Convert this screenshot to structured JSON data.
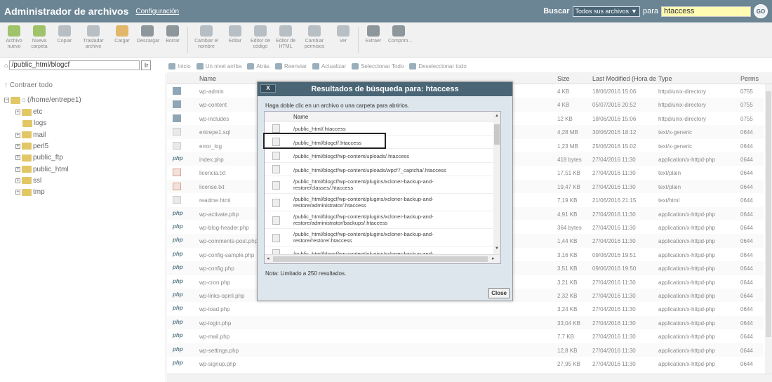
{
  "header": {
    "title": "Administrador de archivos",
    "settings_link": "Configuración",
    "search_label": "Buscar",
    "search_scope": "Todos sus archivos",
    "search_for_label": "para",
    "search_query": "htaccess",
    "go_label": "GO"
  },
  "toolbar": [
    {
      "icon": "new-file-icon",
      "label": "Archivo nuevo",
      "style": "green"
    },
    {
      "icon": "new-folder-icon",
      "label": "Nueva carpeta",
      "style": "green"
    },
    {
      "icon": "copy-icon",
      "label": "Copiar",
      "style": "grey"
    },
    {
      "icon": "move-icon",
      "label": "Trasladar archivo",
      "style": "grey"
    },
    {
      "icon": "upload-icon",
      "label": "Cargar",
      "style": "orange"
    },
    {
      "icon": "download-icon",
      "label": "Descargar",
      "style": "dark"
    },
    {
      "icon": "delete-icon",
      "label": "Borrar",
      "style": "dark"
    },
    {
      "icon": "rename-icon",
      "label": "Cambiar el nombre",
      "style": "grey"
    },
    {
      "icon": "edit-icon",
      "label": "Editar",
      "style": "grey"
    },
    {
      "icon": "code-editor-icon",
      "label": "Editor de código",
      "style": "grey"
    },
    {
      "icon": "html-editor-icon",
      "label": "Editor de HTML",
      "style": "grey"
    },
    {
      "icon": "permissions-icon",
      "label": "Cambiar permisos",
      "style": "grey"
    },
    {
      "icon": "view-icon",
      "label": "Ver",
      "style": "grey"
    },
    {
      "icon": "extract-icon",
      "label": "Extraer",
      "style": "dark"
    },
    {
      "icon": "compress-icon",
      "label": "Comprim...",
      "style": "dark"
    }
  ],
  "path": {
    "value": "/public_html/blogcf",
    "go": "Ir"
  },
  "nav": [
    "Inicio",
    "Un nivel arriba",
    "Atrás",
    "Reenviar",
    "Actualizar",
    "Seleccionar Todo",
    "Deseleccionar todo"
  ],
  "tree": {
    "collapse_all": "Contraer todo",
    "root": "(/home/entrepe1)",
    "items": [
      "etc",
      "logs",
      "mail",
      "perl5",
      "public_ftp",
      "public_html",
      "ssl",
      "tmp"
    ]
  },
  "columns": {
    "name": "Name",
    "size": "Size",
    "modified": "Last Modified (Hora de",
    "type": "Type",
    "perms": "Perms"
  },
  "files": [
    {
      "name": "wp-admin",
      "size": "4 KB",
      "date": "18/06/2016 15:06",
      "type": "httpd/unix-directory",
      "perms": "0755",
      "icon": "dir"
    },
    {
      "name": "wp-content",
      "size": "4 KB",
      "date": "05/07/2016 20:52",
      "type": "httpd/unix-directory",
      "perms": "0755",
      "icon": "dir"
    },
    {
      "name": "wp-includes",
      "size": "12 KB",
      "date": "18/06/2016 15:06",
      "type": "httpd/unix-directory",
      "perms": "0755",
      "icon": "dir"
    },
    {
      "name": "entrepe1.sql",
      "size": "4,28 MB",
      "date": "30/06/2016 18:12",
      "type": "text/x-generic",
      "perms": "0644",
      "icon": "txt"
    },
    {
      "name": "error_log",
      "size": "1,23 MB",
      "date": "25/06/2016 15:02",
      "type": "text/x-generic",
      "perms": "0644",
      "icon": "txt"
    },
    {
      "name": "index.php",
      "size": "418 bytes",
      "date": "27/04/2016 11:30",
      "type": "application/x-httpd-php",
      "perms": "0644",
      "icon": "php"
    },
    {
      "name": "licencia.txt",
      "size": "17,51 KB",
      "date": "27/04/2016 11:30",
      "type": "text/plain",
      "perms": "0644",
      "icon": "red"
    },
    {
      "name": "license.txt",
      "size": "19,47 KB",
      "date": "27/04/2016 11:30",
      "type": "text/plain",
      "perms": "0644",
      "icon": "red"
    },
    {
      "name": "readme.html",
      "size": "7,19 KB",
      "date": "21/06/2016 21:15",
      "type": "text/html",
      "perms": "0644",
      "icon": "txt"
    },
    {
      "name": "wp-activate.php",
      "size": "4,91 KB",
      "date": "27/04/2016 11:30",
      "type": "application/x-httpd-php",
      "perms": "0644",
      "icon": "php"
    },
    {
      "name": "wp-blog-header.php",
      "size": "364 bytes",
      "date": "27/04/2016 11:30",
      "type": "application/x-httpd-php",
      "perms": "0644",
      "icon": "php"
    },
    {
      "name": "wp-comments-post.php",
      "size": "1,44 KB",
      "date": "27/04/2016 11:30",
      "type": "application/x-httpd-php",
      "perms": "0644",
      "icon": "php"
    },
    {
      "name": "wp-config-sample.php",
      "size": "3,16 KB",
      "date": "09/06/2016 19:51",
      "type": "application/x-httpd-php",
      "perms": "0644",
      "icon": "php"
    },
    {
      "name": "wp-config.php",
      "size": "3,51 KB",
      "date": "09/06/2016 19:50",
      "type": "application/x-httpd-php",
      "perms": "0644",
      "icon": "php"
    },
    {
      "name": "wp-cron.php",
      "size": "3,21 KB",
      "date": "27/04/2016 11:30",
      "type": "application/x-httpd-php",
      "perms": "0644",
      "icon": "php"
    },
    {
      "name": "wp-links-opml.php",
      "size": "2,32 KB",
      "date": "27/04/2016 11:30",
      "type": "application/x-httpd-php",
      "perms": "0644",
      "icon": "php"
    },
    {
      "name": "wp-load.php",
      "size": "3,24 KB",
      "date": "27/04/2016 11:30",
      "type": "application/x-httpd-php",
      "perms": "0644",
      "icon": "php"
    },
    {
      "name": "wp-login.php",
      "size": "33,04 KB",
      "date": "27/04/2016 11:30",
      "type": "application/x-httpd-php",
      "perms": "0644",
      "icon": "php"
    },
    {
      "name": "wp-mail.php",
      "size": "7,7 KB",
      "date": "27/04/2016 11:30",
      "type": "application/x-httpd-php",
      "perms": "0644",
      "icon": "php"
    },
    {
      "name": "wp-settings.php",
      "size": "12,8 KB",
      "date": "27/04/2016 11:30",
      "type": "application/x-httpd-php",
      "perms": "0644",
      "icon": "php"
    },
    {
      "name": "wp-signup.php",
      "size": "27,95 KB",
      "date": "27/04/2016 11:30",
      "type": "application/x-httpd-php",
      "perms": "0644",
      "icon": "php"
    }
  ],
  "dialog": {
    "title": "Resultados de búsqueda para: htaccess",
    "close_x": "X",
    "instructions": "Haga doble clic en un archivo o una carpeta para abrirlos.",
    "column_name": "Name",
    "results": [
      "/public_html/.htaccess",
      "/public_html/blogcf/.htaccess",
      "/public_html/blogcf/wp-content/uploads/.htaccess",
      "/public_html/blogcf/wp-content/uploads/wpcf7_captcha/.htaccess",
      "/public_html/blogcf/wp-content/plugins/xcloner-backup-and-restore/classes/.htaccess",
      "/public_html/blogcf/wp-content/plugins/xcloner-backup-and-restore/administrator/.htaccess",
      "/public_html/blogcf/wp-content/plugins/xcloner-backup-and-restore/administrator/backups/.htaccess",
      "/public_html/blogcf/wp-content/plugins/xcloner-backup-and-restore/restore/.htaccess",
      "/public_html/blogcf/wp-content/plugins/xcloner-backup-and-"
    ],
    "note": "Nota: Limitado a 250 resultados.",
    "close_button": "Close"
  }
}
